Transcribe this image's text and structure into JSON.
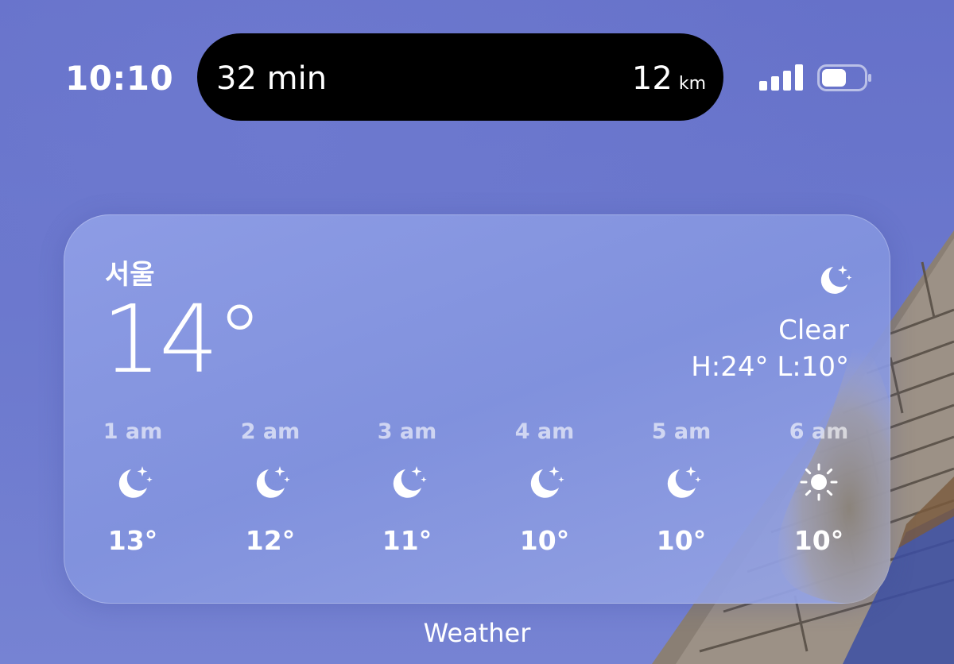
{
  "status_bar": {
    "time": "10:10",
    "live_activity": {
      "left_text": "32 min",
      "distance_value": "12",
      "distance_unit": "km"
    },
    "signal_bars": 4,
    "signal_icon": "cellular-signal-icon",
    "battery_icon": "battery-icon"
  },
  "widget": {
    "city": "서울",
    "temperature": "14°",
    "condition_icon": "moon-stars-icon",
    "condition": "Clear",
    "high_low": "H:24° L:10°",
    "hourly": [
      {
        "time": "1 am",
        "icon": "moon-stars-icon",
        "temp": "13°"
      },
      {
        "time": "2 am",
        "icon": "moon-stars-icon",
        "temp": "12°"
      },
      {
        "time": "3 am",
        "icon": "moon-stars-icon",
        "temp": "11°"
      },
      {
        "time": "4 am",
        "icon": "moon-stars-icon",
        "temp": "10°"
      },
      {
        "time": "5 am",
        "icon": "moon-stars-icon",
        "temp": "10°"
      },
      {
        "time": "6 am",
        "icon": "sun-icon",
        "temp": "10°"
      }
    ]
  },
  "app_label": "Weather",
  "colors": {
    "background": "#6a76cc",
    "widget": "#8b9be3",
    "island": "#000000",
    "text": "#ffffff"
  }
}
